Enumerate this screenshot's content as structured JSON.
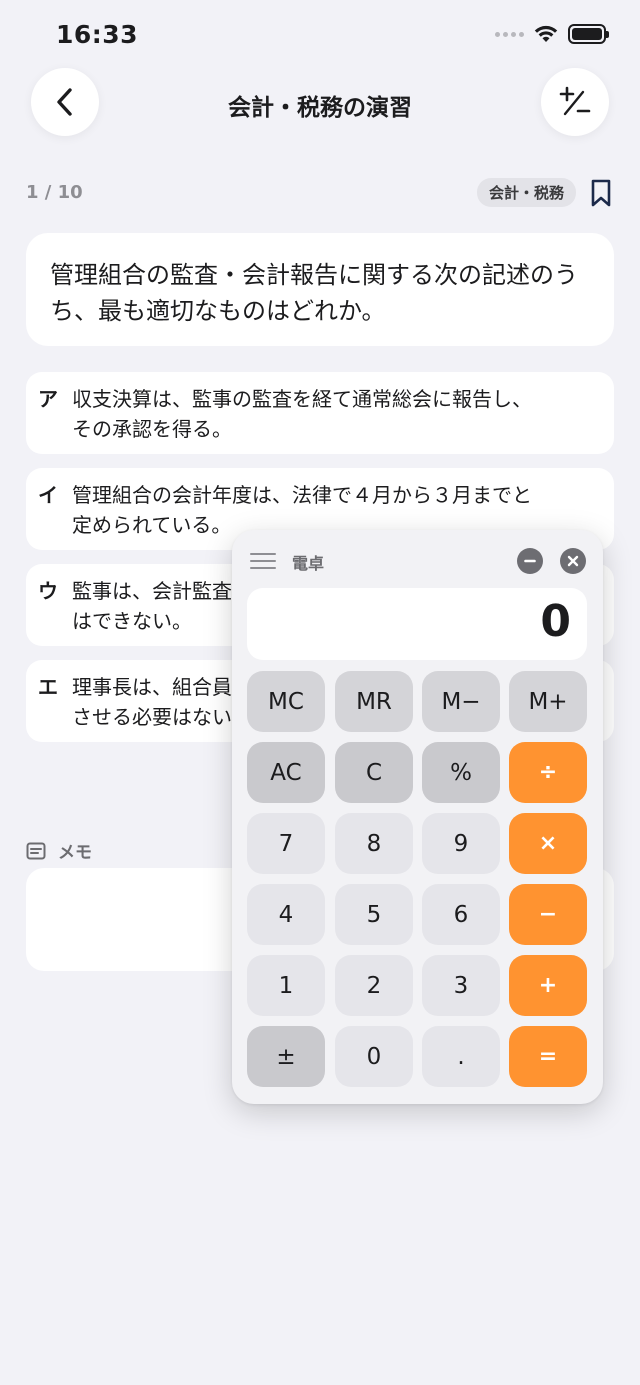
{
  "status_bar": {
    "time": "16:33"
  },
  "nav": {
    "title": "会計・税務の演習",
    "pm_label": "+/−"
  },
  "question_meta": {
    "progress": "1 / 10",
    "category": "会計・税務"
  },
  "question": {
    "text": "管理組合の監査・会計報告に関する次の記述のうち、最も適切なものはどれか。",
    "options": [
      {
        "letter": "ア",
        "lines": [
          "収支決算は、監事の監査を経て通常総会に報告し、",
          "その承認を得る。"
        ]
      },
      {
        "letter": "イ",
        "lines": [
          "管理組合の会計年度は、法律で４月から３月までと",
          "定められている。"
        ]
      },
      {
        "letter": "ウ",
        "lines": [
          "監事は、会計監査",
          "はできない。"
        ]
      },
      {
        "letter": "エ",
        "lines": [
          "理事長は、組合員",
          "させる必要はない"
        ]
      }
    ]
  },
  "memo": {
    "label": "メモ"
  },
  "calculator": {
    "title": "電卓",
    "display": "0",
    "keys": [
      [
        "MC",
        "MR",
        "M−",
        "M+"
      ],
      [
        "AC",
        "C",
        "%",
        "÷"
      ],
      [
        "7",
        "8",
        "9",
        "×"
      ],
      [
        "4",
        "5",
        "6",
        "−"
      ],
      [
        "1",
        "2",
        "3",
        "+"
      ],
      [
        "±",
        "0",
        ".",
        "="
      ]
    ],
    "operator_color": "#ff9330"
  },
  "icons": [
    "back-chevron-icon",
    "plus-minus-icon",
    "bookmark-icon",
    "memo-icon",
    "drag-handle-icon",
    "minimize-icon",
    "close-icon",
    "wifi-icon",
    "battery-icon"
  ]
}
